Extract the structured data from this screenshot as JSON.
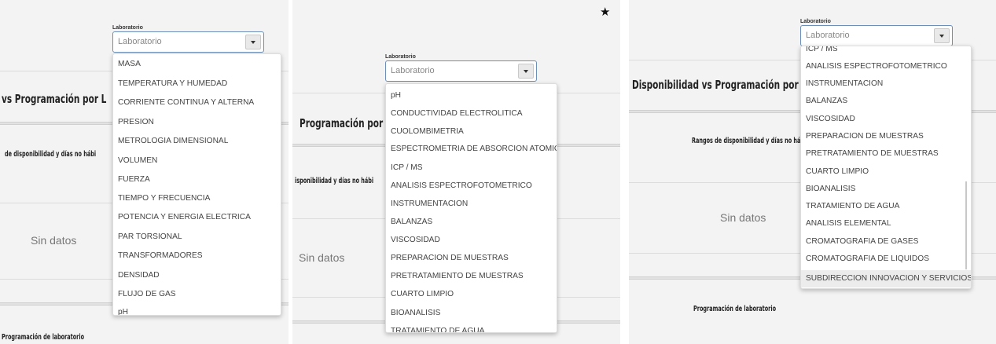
{
  "lab_label": "Laboratorio",
  "lab_placeholder": "Laboratorio",
  "sin_datos": "Sin datos",
  "title_disponibilidad": "Disponibilidad vs Programación por L",
  "title_part1": "vs Programación por L",
  "title_part2": "Programación por L",
  "rangos_full": "Rangos de disponibilidad y días no hábi",
  "rangos_part1": "de disponibilidad y días no hábi",
  "rangos_part2": "isponibilidad y días no hábi",
  "programacion_lab": "Programación de laboratorio",
  "programacion_lab_cut": "Programación de laboratorio",
  "star_icon": "★",
  "panel1_items": [
    "MASA",
    "TEMPERATURA Y HUMEDAD",
    "CORRIENTE CONTINUA Y ALTERNA",
    "PRESION",
    "METROLOGIA DIMENSIONAL",
    "VOLUMEN",
    "FUERZA",
    "TIEMPO Y FRECUENCIA",
    "POTENCIA Y ENERGIA ELECTRICA",
    "PAR TORSIONAL",
    "TRANSFORMADORES",
    "DENSIDAD",
    "FLUJO DE GAS",
    "pH"
  ],
  "panel2_items": [
    "pH",
    "CONDUCTIVIDAD ELECTROLITICA",
    "CUOLOMBIMETRIA",
    "ESPECTROMETRIA DE ABSORCION ATOMICA",
    "ICP / MS",
    "ANALISIS ESPECTROFOTOMETRICO",
    "INSTRUMENTACION",
    "BALANZAS",
    "VISCOSIDAD",
    "PREPARACION DE MUESTRAS",
    "PRETRATAMIENTO DE MUESTRAS",
    "CUARTO LIMPIO",
    "BIOANALISIS",
    "TRATAMIENTO DE AGUA"
  ],
  "panel3_items": [
    "ICP / MS",
    "ANALISIS ESPECTROFOTOMETRICO",
    "INSTRUMENTACION",
    "BALANZAS",
    "VISCOSIDAD",
    "PREPARACION DE MUESTRAS",
    "PRETRATAMIENTO DE MUESTRAS",
    "CUARTO LIMPIO",
    "BIOANALISIS",
    "TRATAMIENTO DE AGUA",
    "ANALISIS ELEMENTAL",
    "CROMATOGRAFIA DE GASES",
    "CROMATOGRAFIA DE LIQUIDOS",
    "SUBDIRECCION INNOVACION Y SERVICIOS..."
  ]
}
